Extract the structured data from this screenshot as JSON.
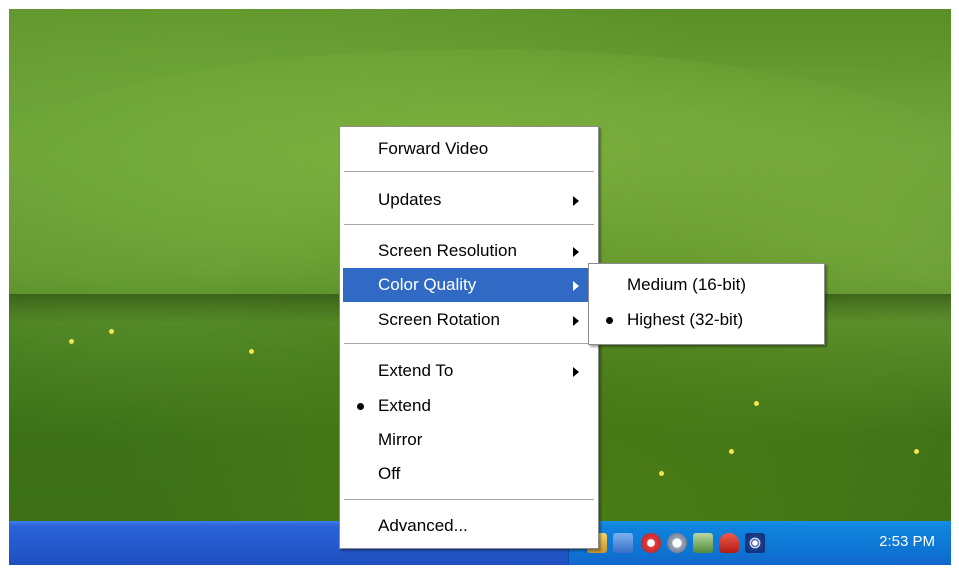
{
  "context_menu": {
    "items": [
      {
        "label": "Forward Video",
        "submenu": false,
        "checked": false
      },
      {
        "label": "Updates",
        "submenu": true,
        "checked": false
      },
      {
        "label": "Screen Resolution",
        "submenu": true,
        "checked": false
      },
      {
        "label": "Color Quality",
        "submenu": true,
        "checked": false,
        "highlighted": true
      },
      {
        "label": "Screen Rotation",
        "submenu": true,
        "checked": false
      },
      {
        "label": "Extend To",
        "submenu": true,
        "checked": false
      },
      {
        "label": "Extend",
        "submenu": false,
        "checked": true
      },
      {
        "label": "Mirror",
        "submenu": false,
        "checked": false
      },
      {
        "label": "Off",
        "submenu": false,
        "checked": false
      },
      {
        "label": "Advanced...",
        "submenu": false,
        "checked": false
      }
    ]
  },
  "color_quality_submenu": {
    "items": [
      {
        "label": "Medium (16-bit)",
        "checked": false
      },
      {
        "label": "Highest (32-bit)",
        "checked": true
      }
    ]
  },
  "taskbar": {
    "tray_icons": [
      "network-icon",
      "display-settings-icon",
      "security-shield-icon",
      "speaker-icon",
      "monitor-icon",
      "red-hat-icon",
      "wireless-icon"
    ],
    "clock": "2:53 PM"
  },
  "colors": {
    "menu_highlight": "#316ac5",
    "taskbar": "#2458cc",
    "tray": "#0e74d3"
  }
}
